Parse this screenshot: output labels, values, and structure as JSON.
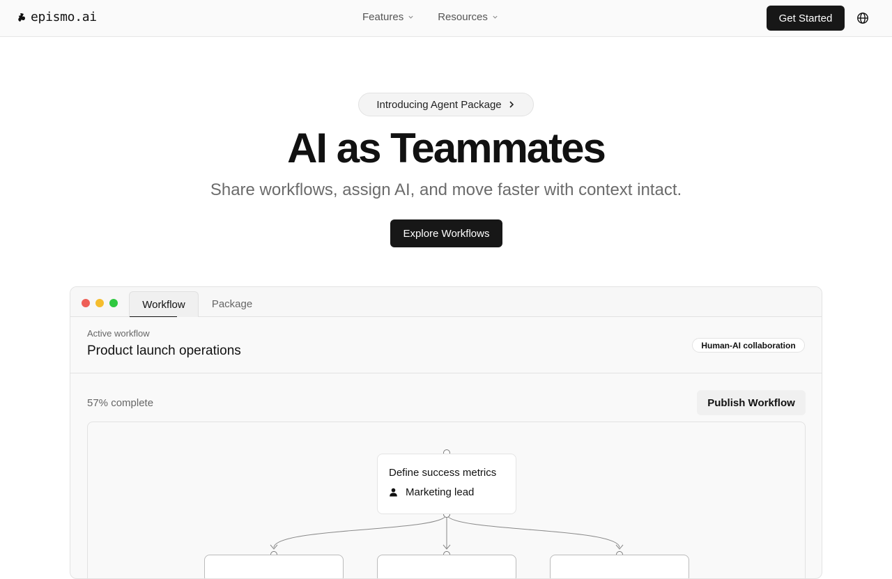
{
  "nav": {
    "logo_text": "epismo.ai",
    "logo_icon": "epismo-logo-icon",
    "menu": [
      {
        "label": "Features",
        "icon": "chevron-down-icon"
      },
      {
        "label": "Resources",
        "icon": "chevron-down-icon"
      }
    ],
    "cta_label": "Get Started",
    "language_icon": "globe-icon"
  },
  "hero": {
    "announcement": "Introducing Agent Package",
    "announcement_icon": "chevron-right-icon",
    "title": "AI as Teammates",
    "subtitle": "Share workflows, assign AI, and move faster with context intact.",
    "cta_label": "Explore Workflows"
  },
  "app": {
    "tabs": [
      {
        "label": "Workflow",
        "active": true
      },
      {
        "label": "Package",
        "active": false
      }
    ],
    "workflow": {
      "kicker": "Active workflow",
      "title": "Product launch operations",
      "badge": "Human-AI collaboration",
      "progress_percent": 57,
      "progress_text": "57% complete",
      "publish_label": "Publish Workflow",
      "nodes": [
        {
          "title": "Define success metrics",
          "assignee": "Marketing lead",
          "assignee_icon": "user-icon"
        }
      ]
    }
  },
  "colors": {
    "primary_button": "#171717",
    "traffic_red": "#ee5f57",
    "traffic_yellow": "#f5bd2e",
    "traffic_green": "#2fc840"
  }
}
